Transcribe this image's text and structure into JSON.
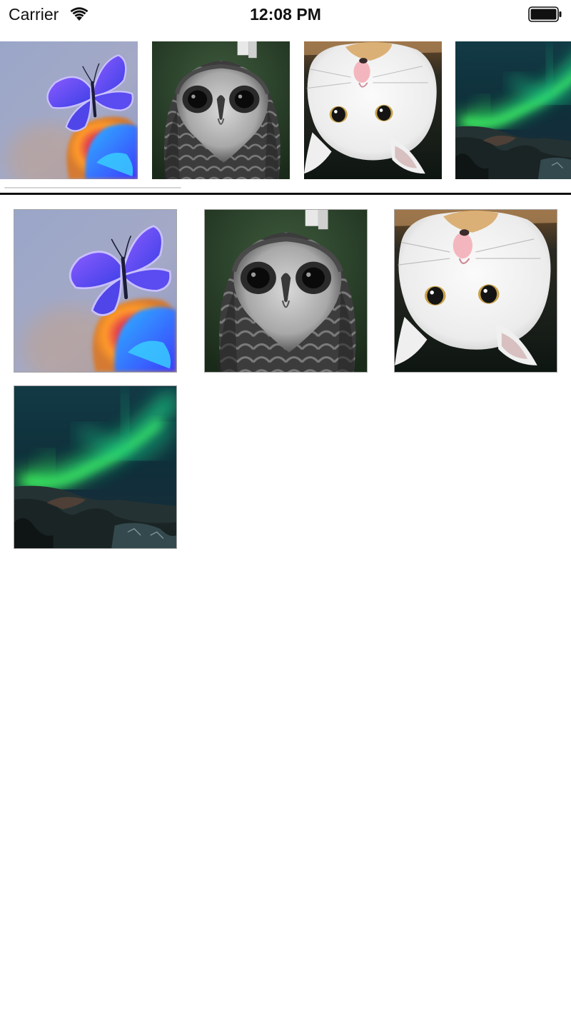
{
  "status_bar": {
    "carrier": "Carrier",
    "time": "12:08 PM",
    "wifi_icon": "wifi-icon",
    "battery_icon": "battery-full-icon"
  },
  "photos": [
    {
      "subject": "butterfly"
    },
    {
      "subject": "owl"
    },
    {
      "subject": "cat"
    },
    {
      "subject": "aurora"
    }
  ],
  "colors": {
    "background": "#ffffff",
    "divider": "#111111"
  }
}
